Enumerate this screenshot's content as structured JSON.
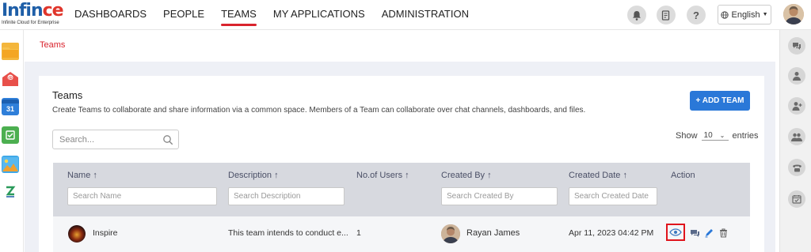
{
  "brand": {
    "logo_main": "Infin",
    "logo_accent": "ce",
    "tagline": "Infinite Cloud for Enterprise",
    "accent": "#d9232d",
    "primary": "#2a78d8"
  },
  "nav": {
    "items": [
      "DASHBOARDS",
      "PEOPLE",
      "TEAMS",
      "MY APPLICATIONS",
      "ADMINISTRATION"
    ],
    "active": "TEAMS"
  },
  "topbar": {
    "icons": [
      "bell-icon",
      "report-icon",
      "help-icon"
    ],
    "language": "English"
  },
  "left_sidebar": {
    "icons": [
      "folder-icon",
      "mail-icon",
      "calendar-icon",
      "tasks-icon",
      "gallery-icon",
      "app-icon"
    ],
    "calendar_day": "31"
  },
  "right_sidebar": {
    "icons": [
      "chat-icon",
      "user-icon",
      "user-add-icon",
      "users-icon",
      "phone-icon",
      "calendar-check-icon"
    ]
  },
  "breadcrumb": "Teams",
  "page": {
    "title": "Teams",
    "description": "Create Teams to collaborate and share information via a common space. Members of a Team can collaborate over chat channels, dashboards, and files.",
    "add_button": "+ ADD TEAM",
    "search_placeholder": "Search...",
    "show_label": "Show",
    "show_value": "10",
    "entries_label": "entries"
  },
  "table": {
    "columns": [
      {
        "label": "Name ↑",
        "filter": "Search Name"
      },
      {
        "label": "Description ↑",
        "filter": "Search Description"
      },
      {
        "label": "No.of Users ↑",
        "filter": ""
      },
      {
        "label": "Created By ↑",
        "filter": "Search Created By"
      },
      {
        "label": "Created Date ↑",
        "filter": "Search Created Date"
      },
      {
        "label": "Action",
        "filter": ""
      }
    ],
    "rows": [
      {
        "name": "Inspire",
        "description": "This team intends to conduct e...",
        "users": "1",
        "created_by": "Rayan James",
        "created_date": "Apr 11, 2023 04:42 PM",
        "actions": [
          "view-icon",
          "chat-icon",
          "edit-icon",
          "delete-icon"
        ]
      }
    ]
  }
}
